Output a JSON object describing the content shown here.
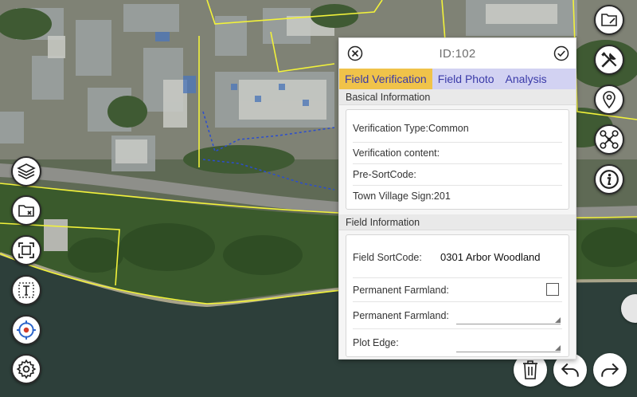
{
  "panel": {
    "title": "ID:102",
    "tabs": [
      {
        "label": "Field Verification",
        "active": true
      },
      {
        "label": "Field Photo",
        "active": false
      },
      {
        "label": "Analysis",
        "active": false
      }
    ],
    "basic_section": {
      "title": "Basical Information",
      "rows": [
        {
          "label": "Verification Type:Common"
        },
        {
          "label": "Verification content:"
        },
        {
          "label": "Pre-SortCode:"
        },
        {
          "label": "Town Village Sign:201"
        }
      ]
    },
    "field_section": {
      "title": "Field Information",
      "sortcode_label": "Field SortCode:",
      "sortcode_value": "0301 Arbor Woodland",
      "farmland_check_label": "Permanent Farmland:",
      "farmland_check_checked": false,
      "farmland_select_label": "Permanent Farmland:",
      "farmland_select_value": "",
      "plot_edge_label": "Plot Edge:",
      "plot_edge_value": ""
    }
  },
  "left_toolbar": [
    {
      "name": "layers-icon"
    },
    {
      "name": "folder-close-icon"
    },
    {
      "name": "fullscreen-icon"
    },
    {
      "name": "text-tool-icon"
    },
    {
      "name": "target-icon"
    },
    {
      "name": "gear-icon"
    }
  ],
  "right_toolbar": [
    {
      "name": "folder-icon"
    },
    {
      "name": "tools-icon"
    },
    {
      "name": "location-pin-icon"
    },
    {
      "name": "drone-icon"
    },
    {
      "name": "info-icon"
    }
  ],
  "bottom_toolbar": [
    {
      "name": "trash-icon"
    },
    {
      "name": "undo-icon"
    },
    {
      "name": "redo-icon"
    }
  ],
  "colors": {
    "tab_active": "#f0c34a",
    "tab_bar": "#d2d2f2",
    "tab_text": "#3a3aa8",
    "boundary_line": "#f2f23a",
    "water": "#2d3f3a"
  }
}
